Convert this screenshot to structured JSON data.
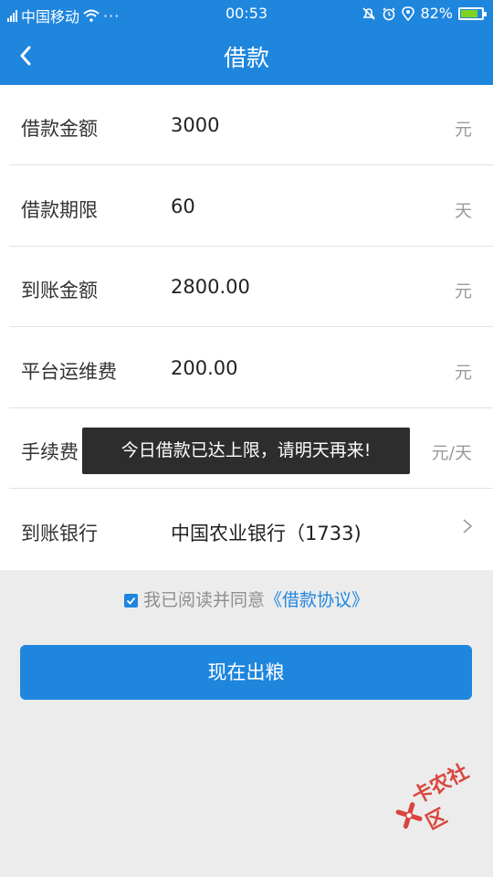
{
  "status_bar": {
    "carrier": "中国移动",
    "time": "00:53",
    "battery": "82%",
    "battery_level": 0.82,
    "more_icon": "more-dots-icon"
  },
  "nav": {
    "title": "借款",
    "back_icon": "chevron-left-icon"
  },
  "form": {
    "rows": [
      {
        "label": "借款金额",
        "value": "3000",
        "unit": "元"
      },
      {
        "label": "借款期限",
        "value": "60",
        "unit": "天"
      },
      {
        "label": "到账金额",
        "value": "2800.00",
        "unit": "元"
      },
      {
        "label": "平台运维费",
        "value": "200.00",
        "unit": "元"
      },
      {
        "label": "手续费",
        "value": "",
        "unit": "元/天"
      },
      {
        "label": "到账银行",
        "value": "中国农业银行（1733)",
        "unit": ""
      }
    ]
  },
  "agreement": {
    "checked": true,
    "text": "我已阅读并同意",
    "link": "《借款协议》"
  },
  "submit_label": "现在出粮",
  "toast": "今日借款已达上限，请明天再来!",
  "watermark": "卡农社区",
  "colors": {
    "primary": "#1f86de",
    "toast_bg": "#2d2d2d",
    "watermark": "#d8342b"
  }
}
